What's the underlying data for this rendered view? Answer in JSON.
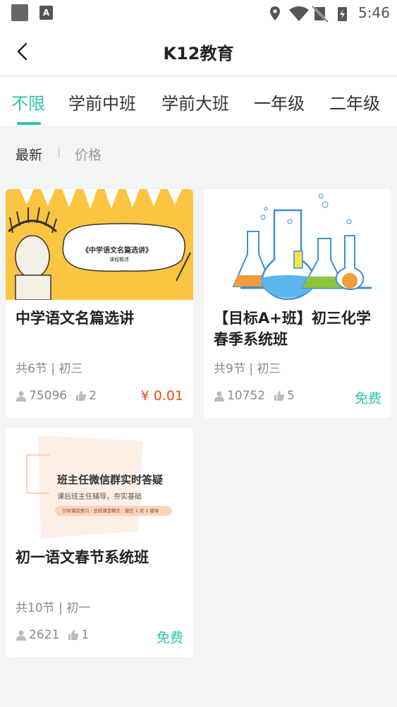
{
  "status_bar": {
    "time": "5:46"
  },
  "header": {
    "title": "K12教育"
  },
  "tabs": [
    {
      "label": "不限",
      "active": true
    },
    {
      "label": "学前中班",
      "active": false
    },
    {
      "label": "学前大班",
      "active": false
    },
    {
      "label": "一年级",
      "active": false
    },
    {
      "label": "二年级",
      "active": false
    }
  ],
  "sort": {
    "newest": "最新",
    "price": "价格"
  },
  "courses": [
    {
      "title": "中学语文名篇选讲",
      "image_title": "《中学语文名篇选讲》",
      "image_subtitle": "课程概述",
      "meta": "共6节 | 初三",
      "views": "75096",
      "likes": "2",
      "price": "¥ 0.01"
    },
    {
      "title": "【目标A+班】初三化学春季系统班",
      "meta": "共9节 | 初三",
      "views": "10752",
      "likes": "5",
      "price": "免费"
    },
    {
      "title": "初一语文春节系统班",
      "image_title": "班主任微信群实时答疑",
      "image_subtitle": "课后班主任辅导，夯实基础",
      "image_tag": "引导课前预习 · 总结课堂精华 · 微信 1 对 1 辅导",
      "meta": "共10节 | 初一",
      "views": "2621",
      "likes": "1",
      "price": "免费"
    }
  ],
  "colors": {
    "accent": "#2ec4a6",
    "price_paid": "#e8501c",
    "background": "#f3f4f6"
  }
}
